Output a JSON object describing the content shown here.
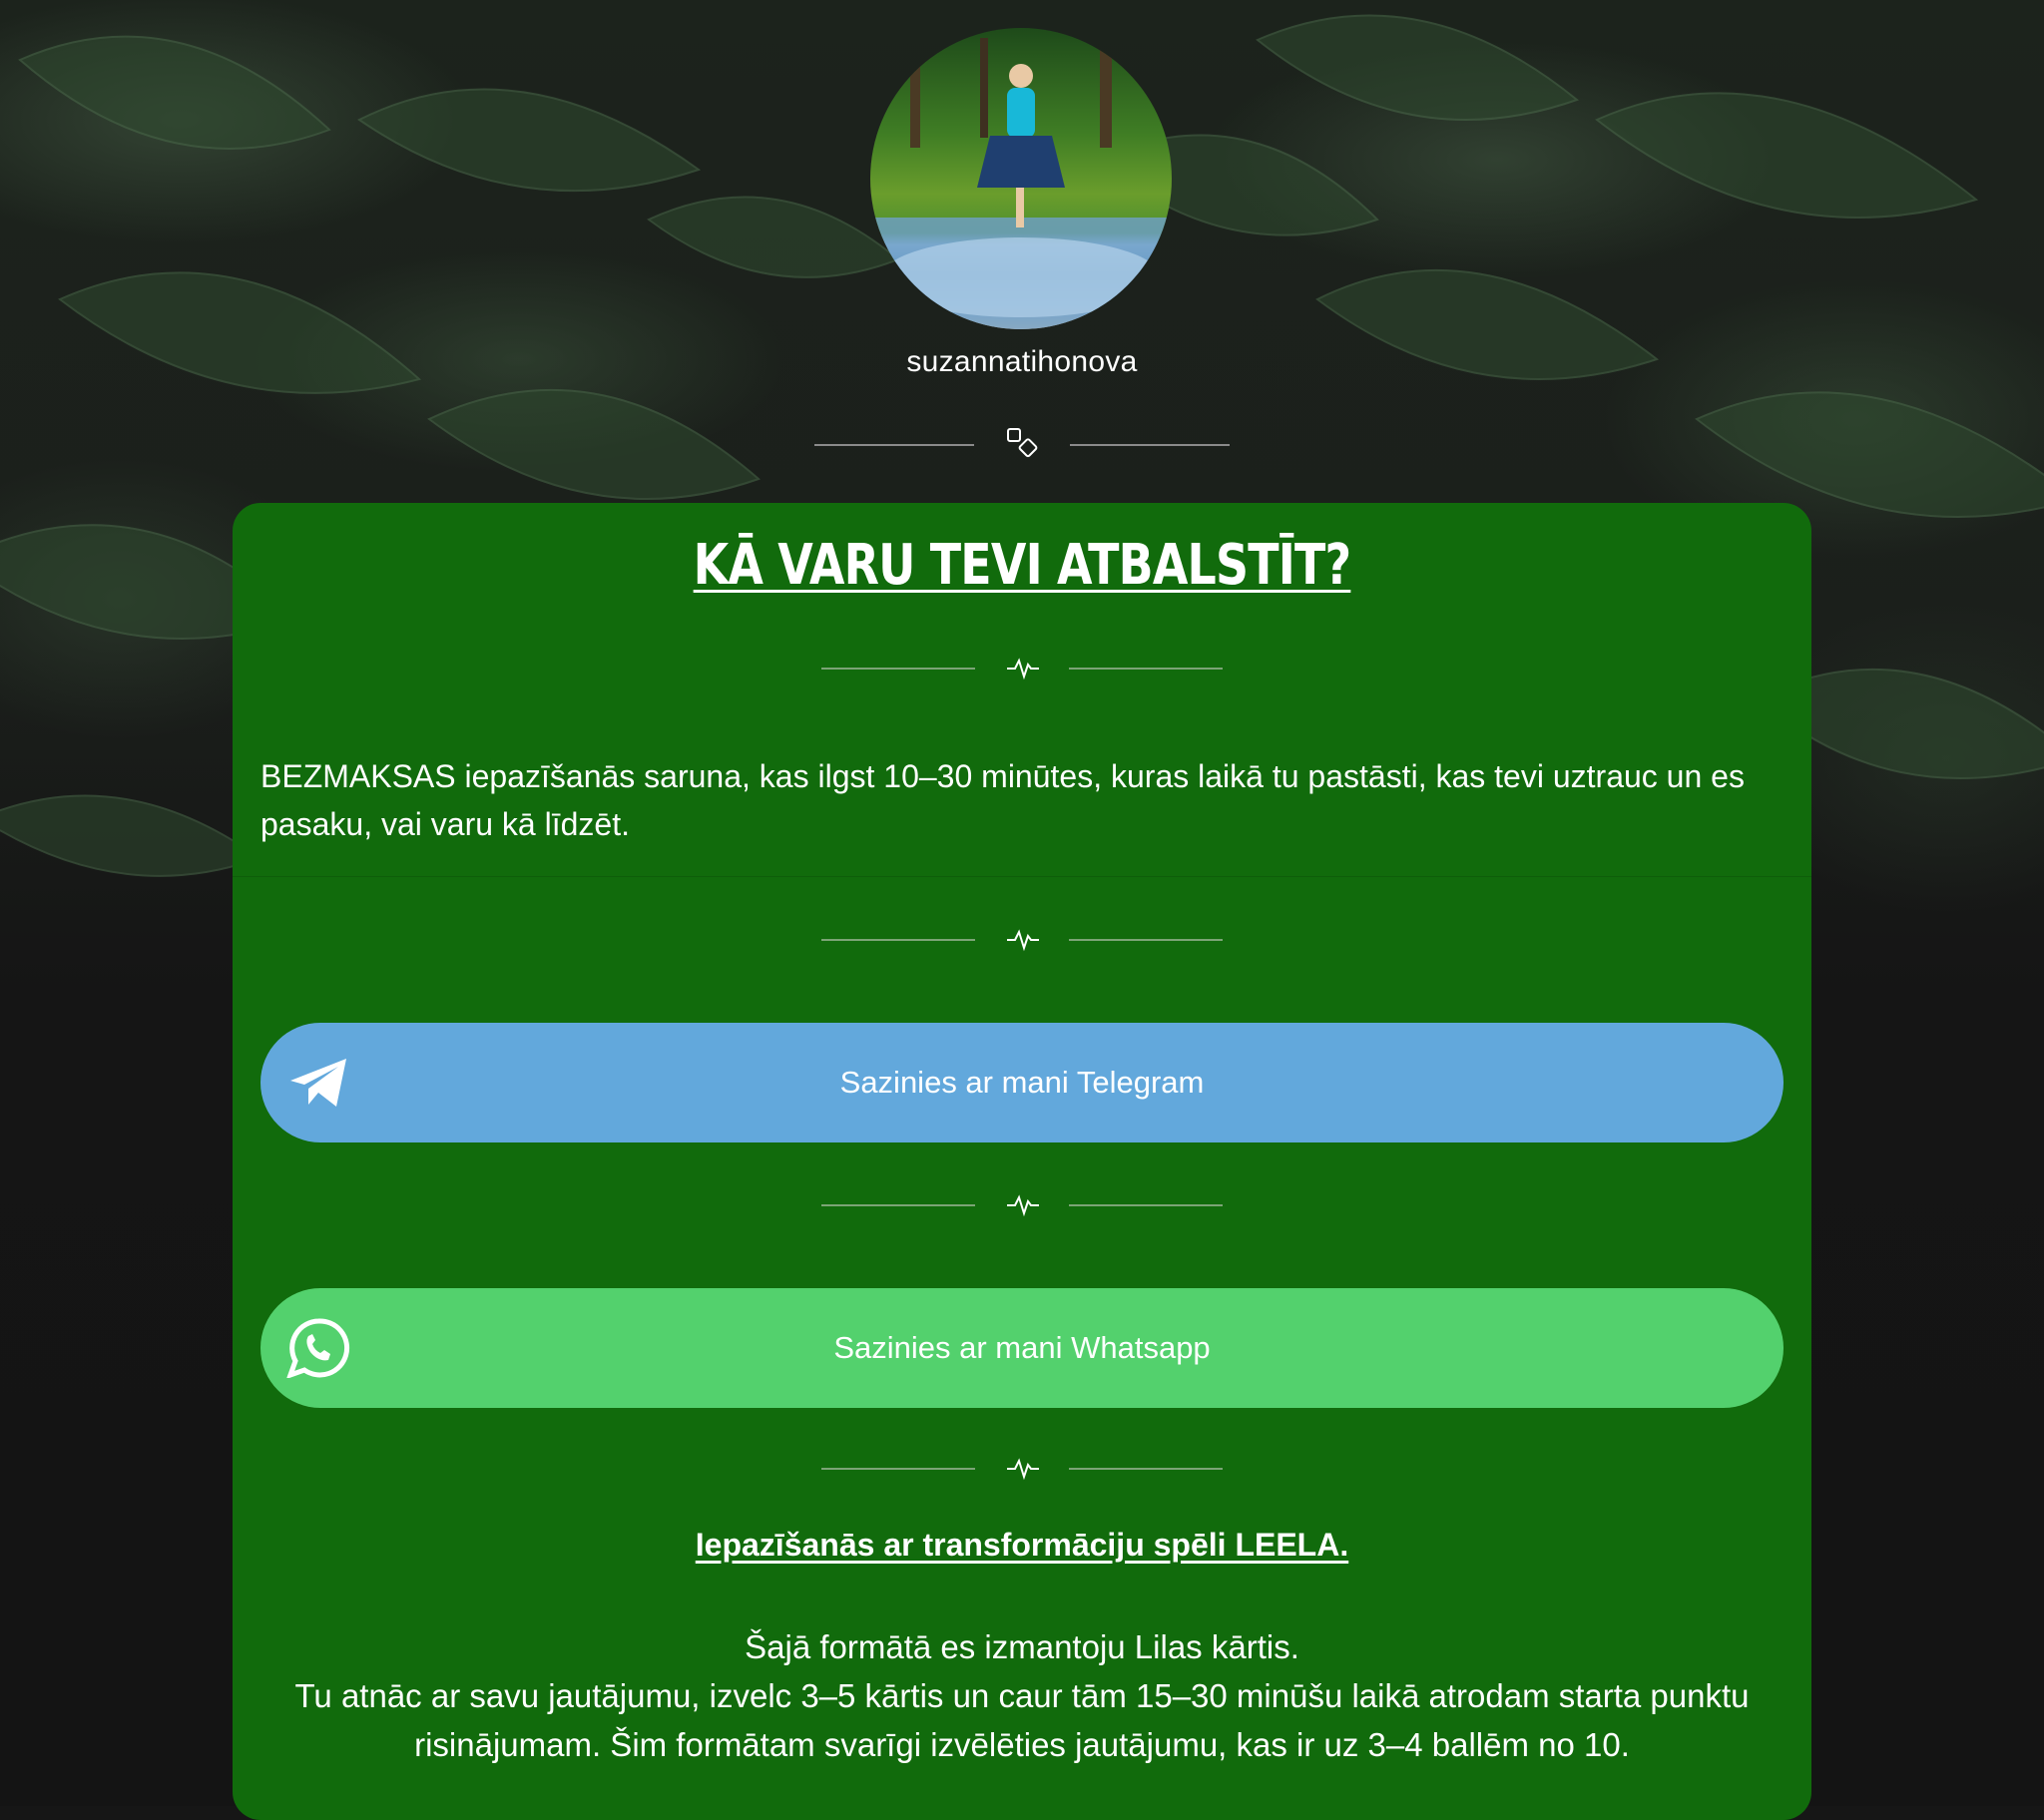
{
  "profile": {
    "username": "suzannatihonova",
    "avatar_icon": "profile-photo"
  },
  "card": {
    "title": "KĀ VARU TEVI ATBALSTĪT?",
    "description": "BEZMAKSAS iepazīšanās saruna, kas ilgst 10–30 minūtes, kuras laikā tu pastāsti, kas tevi uztrauc un es pasaku, vai varu kā līdzēt.",
    "buttons": [
      {
        "label": "Sazinies ar mani Telegram",
        "icon": "telegram-icon",
        "color": "#62a8dc"
      },
      {
        "label": "Sazinies ar mani Whatsapp",
        "icon": "whatsapp-icon",
        "color": "#53d16d"
      }
    ],
    "leela": {
      "title": "Iepazīšanās ar transformāciju spēli LEELA.",
      "line1": "Šajā formātā es izmantoju Lilas kārtis.",
      "line2": "Tu atnāc ar savu jautājumu, izvelc 3–5 kārtis un caur tām 15–30 minūšu laikā atrodam starta punktu risinājumam. Šim formātam svarīgi izvēlēties jautājumu, kas ir uz 3–4 ballēm no 10."
    }
  },
  "colors": {
    "card_bg": "#116b0c",
    "telegram": "#62a8dc",
    "whatsapp": "#53d16d",
    "page_bg": "#161616"
  }
}
